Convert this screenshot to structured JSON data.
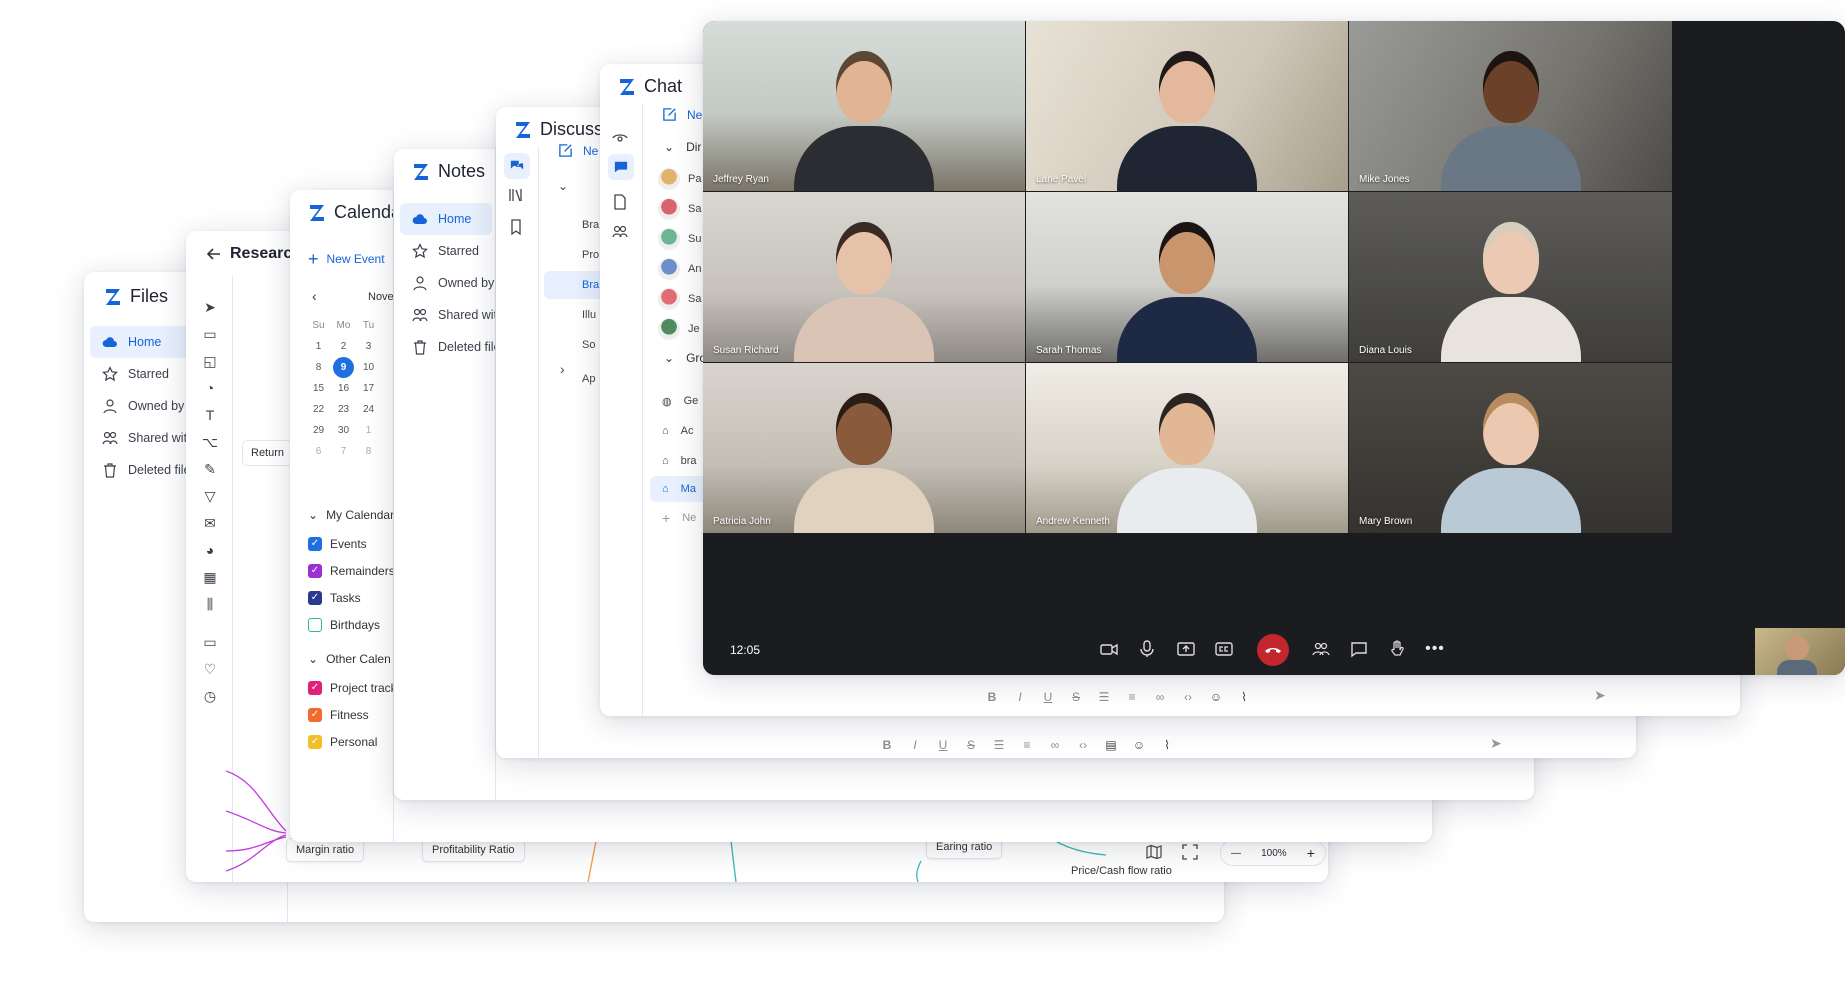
{
  "files": {
    "title": "Files",
    "nav": [
      {
        "label": "Home",
        "icon": "cloud-icon",
        "active": true
      },
      {
        "label": "Starred",
        "icon": "star-icon"
      },
      {
        "label": "Owned by m",
        "icon": "person-icon"
      },
      {
        "label": "Shared with",
        "icon": "people-icon"
      },
      {
        "label": "Deleted files",
        "icon": "trash-icon"
      }
    ]
  },
  "research": {
    "title": "Research",
    "return_label": "Return",
    "mind_nodes": {
      "margin": "Margin ratio",
      "profit": "Profitability Ratio",
      "earing": "Earing ratio",
      "price": "Price/Cash flow ratio"
    },
    "zoom": "100%"
  },
  "calendar": {
    "title": "Calendar",
    "new_event": "New Event",
    "month": "Nove",
    "dow": [
      "Su",
      "Mo",
      "Tu"
    ],
    "days": [
      "1",
      "2",
      "3",
      "8",
      "9",
      "10",
      "15",
      "16",
      "17",
      "22",
      "23",
      "24",
      "29",
      "30",
      "1",
      "6",
      "7",
      "8"
    ],
    "my_title": "My Calendar",
    "my": [
      {
        "label": "Events",
        "color": "#1f6fe0",
        "checked": true
      },
      {
        "label": "Remainders",
        "color": "#9b2fd0",
        "checked": true
      },
      {
        "label": "Tasks",
        "color": "#2a3a8f",
        "checked": true
      },
      {
        "label": "Birthdays",
        "color": "#2fb59a",
        "checked": false
      }
    ],
    "other_title": "Other Calen",
    "other": [
      {
        "label": "Project track",
        "color": "#e0207a",
        "checked": true
      },
      {
        "label": "Fitness",
        "color": "#f26b2c",
        "checked": true
      },
      {
        "label": "Personal",
        "color": "#f2bf2c",
        "checked": true
      }
    ]
  },
  "notes": {
    "title": "Notes",
    "nav": [
      {
        "label": "Home",
        "icon": "cloud-icon",
        "active": true
      },
      {
        "label": "Starred",
        "icon": "star-icon"
      },
      {
        "label": "Owned by m",
        "icon": "person-icon"
      },
      {
        "label": "Shared with",
        "icon": "people-icon"
      },
      {
        "label": "Deleted files",
        "icon": "trash-icon"
      }
    ]
  },
  "discussion": {
    "title": "Discussions",
    "new_label": "Ne",
    "items": [
      "Bra",
      "Pro",
      "Bra",
      "Illu",
      "So",
      "Ap"
    ]
  },
  "chat": {
    "title": "Chat",
    "new_label": "Ne",
    "dir_label": "Dir",
    "contacts": [
      "Pa",
      "Sa",
      "Su",
      "An",
      "Sa",
      "Je"
    ],
    "group_label": "Gro",
    "channels": [
      "Ge",
      "Ac",
      "bra",
      "Ma"
    ],
    "new_channel": "Ne"
  },
  "meeting": {
    "time": "12:05",
    "participants": [
      "Jeffrey Ryan",
      "Lane Pavel",
      "Mike Jones",
      "Susan Richard",
      "Sarah Thomas",
      "Diana Louis",
      "Patricia John",
      "Andrew Kenneth",
      "Mary Brown"
    ],
    "end_color": "#c4262e"
  }
}
